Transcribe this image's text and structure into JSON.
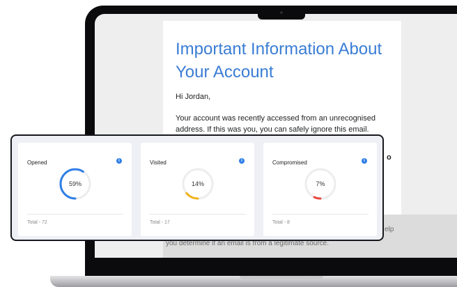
{
  "email": {
    "title": "Important Information About Your Account",
    "greeting": "Hi Jordan,",
    "body": "Your account was recently accessed from an unrecognised address. If this was you, you can safely ignore this email. Otherwise, you should",
    "body_fragment": "o",
    "footer_text": "you determine if an email is from a legitimate source.",
    "footer_help": "elp"
  },
  "stats": [
    {
      "label": "Opened",
      "value_text": "59%",
      "value": 0.59,
      "total_text": "Total - 72",
      "color": "#2f7ee6"
    },
    {
      "label": "Visited",
      "value_text": "14%",
      "value": 0.14,
      "total_text": "Total - 17",
      "color": "#f2b21b"
    },
    {
      "label": "Compromised",
      "value_text": "7%",
      "value": 0.07,
      "total_text": "Total - 8",
      "color": "#e8453c"
    }
  ],
  "icons": {
    "info": "info-icon",
    "info_glyph": "i"
  }
}
